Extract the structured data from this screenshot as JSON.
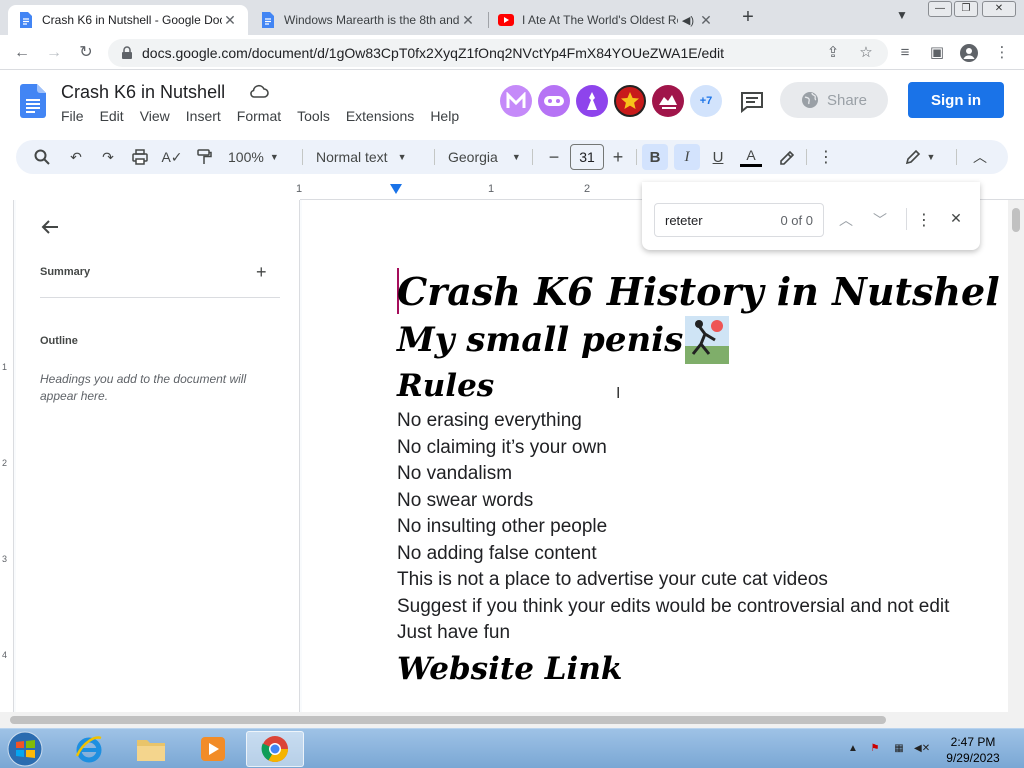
{
  "browser": {
    "tabs": [
      {
        "title": "Crash K6 in Nutshell - Google Docs",
        "icon": "docs-icon",
        "active": true
      },
      {
        "title": "Windows Marearth is the 8th and",
        "icon": "docs-icon",
        "active": false
      },
      {
        "title": "I Ate At The World's Oldest Res",
        "icon": "youtube-icon",
        "active": false
      }
    ],
    "url": "docs.google.com/document/d/1gOw83CpT0fx2XyqZ1fOnq2NVctYp4FmX84YOUeZWA1E/edit"
  },
  "docs": {
    "title": "Crash K6 in Nutshell",
    "menu": [
      "File",
      "Edit",
      "View",
      "Insert",
      "Format",
      "Tools",
      "Extensions",
      "Help"
    ],
    "avatars_more": "+7",
    "share_label": "Share",
    "signin_label": "Sign in",
    "toolbar": {
      "zoom": "100%",
      "style": "Normal text",
      "font": "Georgia",
      "font_size": "31"
    }
  },
  "ruler": {
    "marks": [
      "1",
      "1",
      "2"
    ]
  },
  "vruler": {
    "marks": [
      "1",
      "2",
      "3",
      "4"
    ]
  },
  "sidepanel": {
    "summary_label": "Summary",
    "outline_label": "Outline",
    "hint": "Headings you add to the document will appear here."
  },
  "document": {
    "heading1": "Crash K6 History in Nutshel",
    "heading2": "My small penis",
    "heading_rules": "Rules",
    "rules": [
      "No erasing everything",
      "No claiming it’s your own",
      "No vandalism",
      "No swear words",
      "No insulting other people",
      "No adding false content",
      "This is not a place to advertise your cute cat videos",
      "Suggest if you think your edits would be controversial and not edit",
      "Just have fun"
    ],
    "heading_link": "Website Link"
  },
  "findbar": {
    "query": "reteter",
    "count": "0 of 0"
  },
  "taskbar": {
    "time": "2:47 PM",
    "date": "9/29/2023"
  },
  "colors": {
    "accent": "#1a73e8",
    "toolbar_bg": "#edf2fa",
    "cursor": "#a50e5b"
  }
}
